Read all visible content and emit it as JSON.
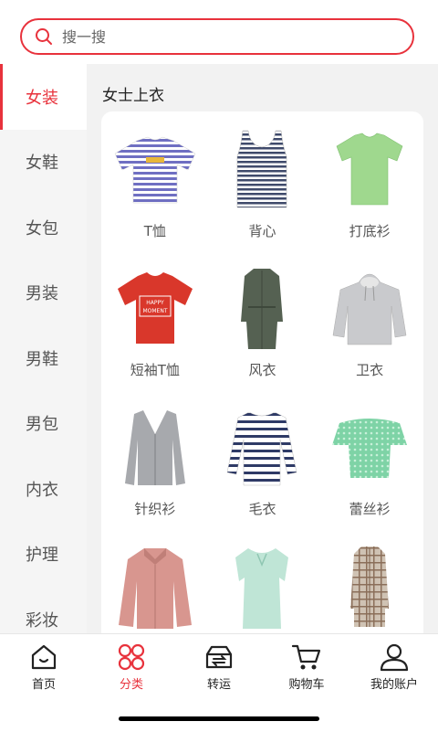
{
  "search": {
    "placeholder": "搜一搜"
  },
  "sidebar": {
    "items": [
      {
        "label": "女装",
        "active": true
      },
      {
        "label": "女鞋"
      },
      {
        "label": "女包"
      },
      {
        "label": "男装"
      },
      {
        "label": "男鞋"
      },
      {
        "label": "男包"
      },
      {
        "label": "内衣"
      },
      {
        "label": "护理"
      },
      {
        "label": "彩妆"
      }
    ]
  },
  "main": {
    "section_title": "女士上衣",
    "products": [
      {
        "label": "T恤",
        "icon": "striped-tshirt-icon"
      },
      {
        "label": "背心",
        "icon": "striped-tank-top-icon"
      },
      {
        "label": "打底衫",
        "icon": "green-tshirt-icon"
      },
      {
        "label": "短袖T恤",
        "icon": "red-tshirt-icon"
      },
      {
        "label": "风衣",
        "icon": "trench-coat-icon"
      },
      {
        "label": "卫衣",
        "icon": "hoodie-icon"
      },
      {
        "label": "针织衫",
        "icon": "cardigan-icon"
      },
      {
        "label": "毛衣",
        "icon": "striped-sweater-icon"
      },
      {
        "label": "蕾丝衫",
        "icon": "lace-top-icon"
      },
      {
        "label": "",
        "icon": "pink-coat-icon"
      },
      {
        "label": "",
        "icon": "blouse-icon"
      },
      {
        "label": "",
        "icon": "plaid-coat-icon"
      }
    ],
    "red_tshirt_text": [
      "HAPPY",
      "MOMENT"
    ]
  },
  "bottom_nav": {
    "items": [
      {
        "label": "首页",
        "icon": "home-icon"
      },
      {
        "label": "分类",
        "icon": "category-icon",
        "active": true
      },
      {
        "label": "转运",
        "icon": "transfer-icon"
      },
      {
        "label": "购物车",
        "icon": "cart-icon"
      },
      {
        "label": "我的账户",
        "icon": "user-icon"
      }
    ]
  },
  "colors": {
    "accent": "#e8323c"
  }
}
